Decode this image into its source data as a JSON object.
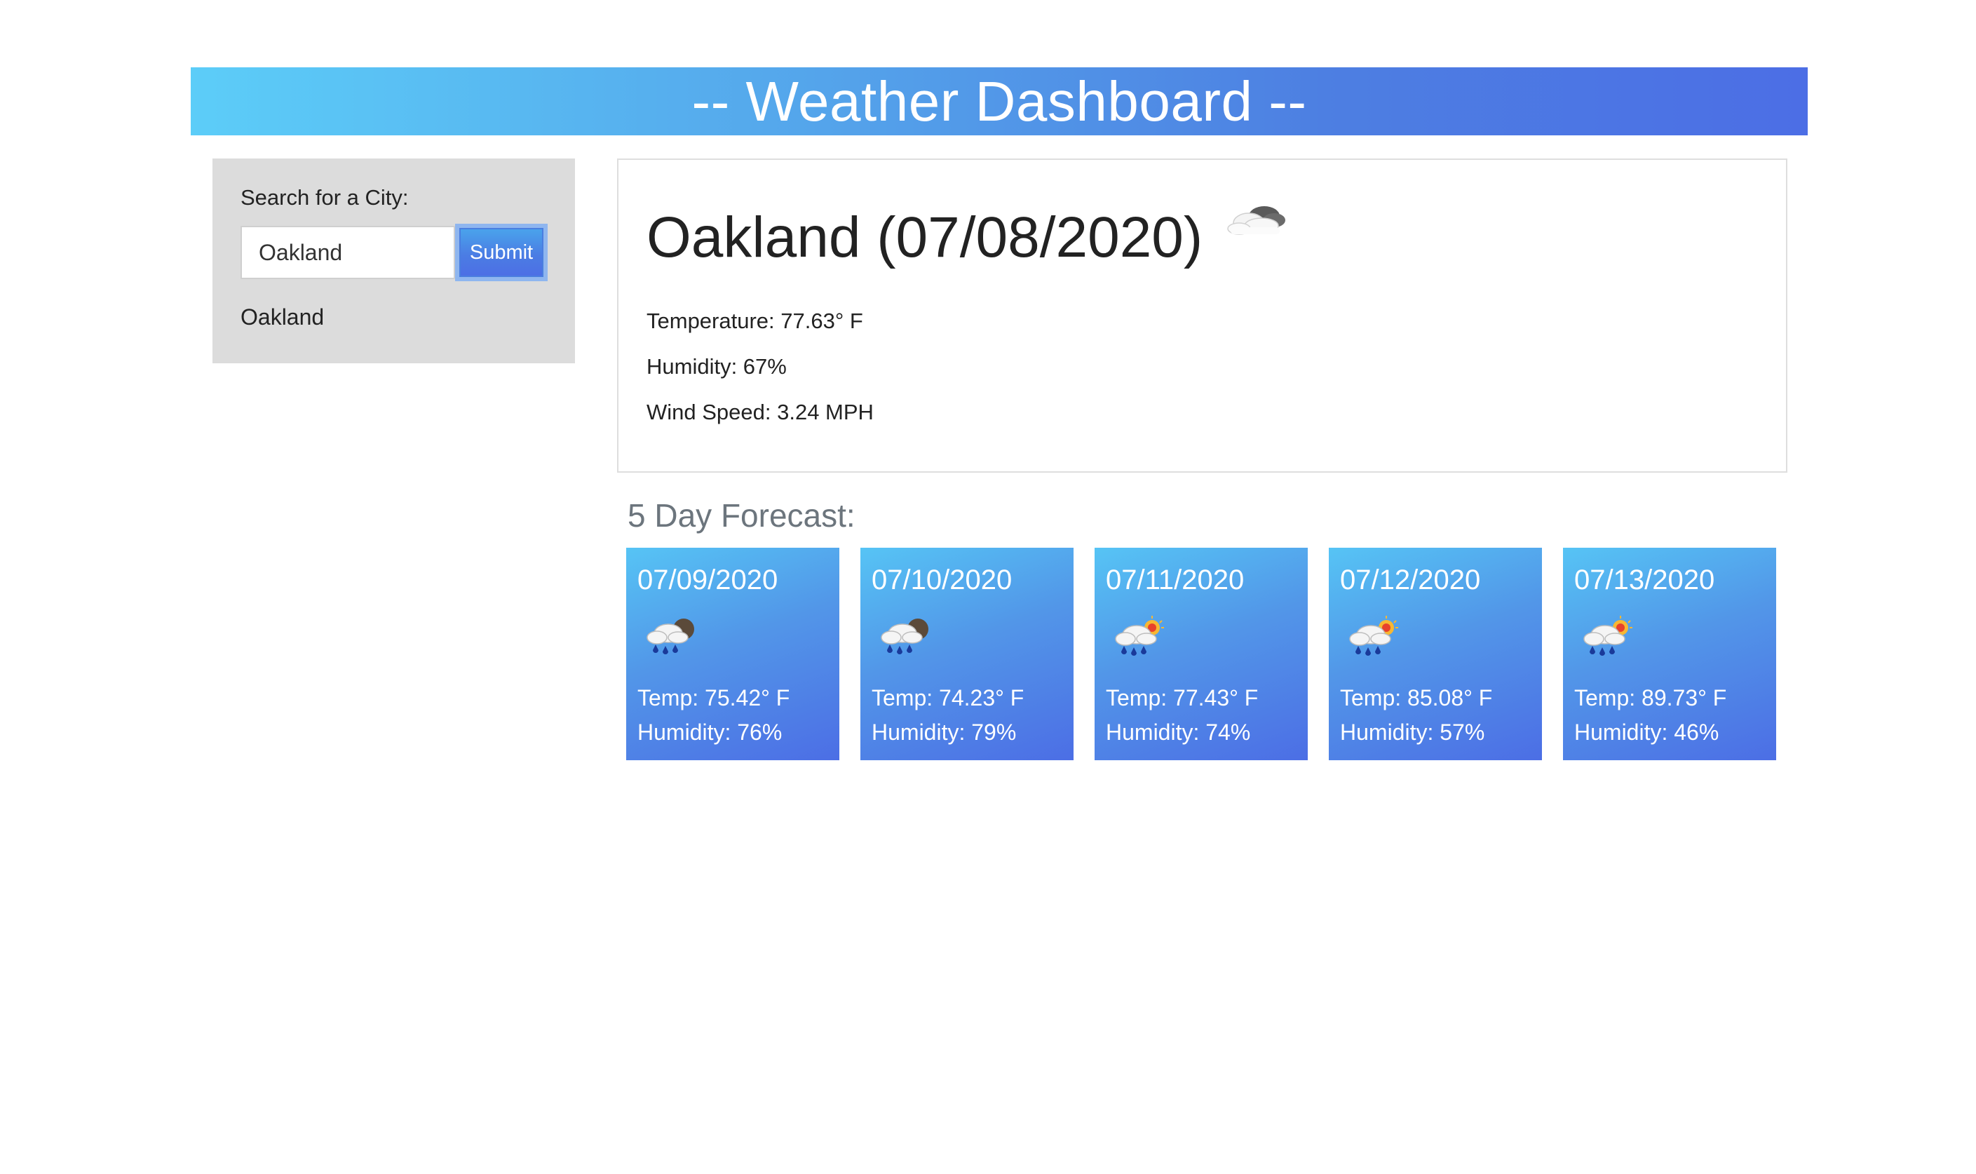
{
  "header": {
    "title": "-- Weather Dashboard --"
  },
  "search": {
    "label": "Search for a City:",
    "input_value": "Oakland",
    "submit_label": "Submit",
    "history": [
      "Oakland"
    ]
  },
  "current": {
    "title": "Oakland (07/08/2020)",
    "icon": "cloudy-icon",
    "temperature": "Temperature: 77.63° F",
    "humidity": "Humidity: 67%",
    "wind": "Wind Speed: 3.24 MPH"
  },
  "forecast": {
    "title": "5 Day Forecast:",
    "days": [
      {
        "date": "07/09/2020",
        "icon": "rain-cloud-night-icon",
        "temp": "Temp: 75.42° F",
        "humidity": "Humidity: 76%"
      },
      {
        "date": "07/10/2020",
        "icon": "rain-cloud-night-icon",
        "temp": "Temp: 74.23° F",
        "humidity": "Humidity: 79%"
      },
      {
        "date": "07/11/2020",
        "icon": "rain-cloud-sun-icon",
        "temp": "Temp: 77.43° F",
        "humidity": "Humidity: 74%"
      },
      {
        "date": "07/12/2020",
        "icon": "rain-cloud-sun-icon",
        "temp": "Temp: 85.08° F",
        "humidity": "Humidity: 57%"
      },
      {
        "date": "07/13/2020",
        "icon": "rain-cloud-sun-icon",
        "temp": "Temp: 89.73° F",
        "humidity": "Humidity: 46%"
      }
    ]
  },
  "colors": {
    "header_gradient_start": "#5ccdf8",
    "header_gradient_end": "#4c6ee5",
    "sidebar_bg": "#dcdcdc",
    "forecast_title": "#6c757d"
  }
}
